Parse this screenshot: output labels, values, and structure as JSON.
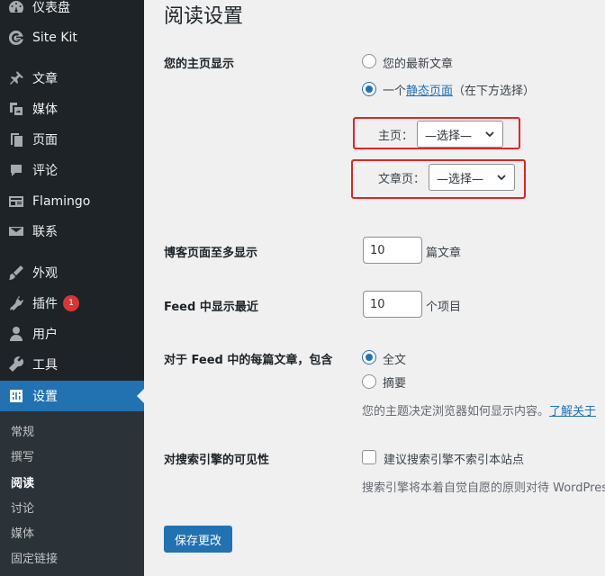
{
  "sidebar": {
    "items": [
      {
        "label": "仪表盘",
        "icon": "dashboard-icon"
      },
      {
        "label": "Site Kit",
        "icon": "sitekit-g-icon"
      },
      {
        "label": "文章",
        "icon": "pin-icon"
      },
      {
        "label": "媒体",
        "icon": "media-icon"
      },
      {
        "label": "页面",
        "icon": "page-icon"
      },
      {
        "label": "评论",
        "icon": "comment-icon"
      },
      {
        "label": "Flamingo",
        "icon": "flamingo-icon"
      },
      {
        "label": "联系",
        "icon": "mail-icon"
      },
      {
        "label": "外观",
        "icon": "brush-icon"
      },
      {
        "label": "插件",
        "icon": "plugin-icon",
        "badge": "1"
      },
      {
        "label": "用户",
        "icon": "user-icon"
      },
      {
        "label": "工具",
        "icon": "wrench-icon"
      },
      {
        "label": "设置",
        "icon": "settings-icon"
      }
    ],
    "submenu": [
      "常规",
      "撰写",
      "阅读",
      "讨论",
      "媒体",
      "固定链接"
    ]
  },
  "page": {
    "title": "阅读设置",
    "homepage": {
      "label": "您的主页显示",
      "option_latest": "您的最新文章",
      "option_static_prefix": "一个",
      "option_static_link": "静态页面",
      "option_static_suffix": "（在下方选择）",
      "front_label": "主页：",
      "front_value": "—选择—",
      "posts_label": "文章页：",
      "posts_value": "—选择—"
    },
    "blog_pages": {
      "label": "博客页面至多显示",
      "value": "10",
      "unit": "篇文章"
    },
    "feed_recent": {
      "label": "Feed 中显示最近",
      "value": "10",
      "unit": "个项目"
    },
    "feed_content": {
      "label": "对于 Feed 中的每篇文章，包含",
      "option_full": "全文",
      "option_summary": "摘要",
      "desc_prefix": "您的主题决定浏览器如何显示内容。",
      "desc_link": "了解关于"
    },
    "search_visibility": {
      "label": "对搜索引擎的可见性",
      "checkbox_label": "建议搜索引擎不索引本站点",
      "desc": "搜索引擎将本着自觉自愿的原则对待 WordPress"
    },
    "save_button": "保存更改"
  },
  "colors": {
    "accent": "#2271b1",
    "sidebar": "#1d2327",
    "highlight": "#e02424"
  }
}
